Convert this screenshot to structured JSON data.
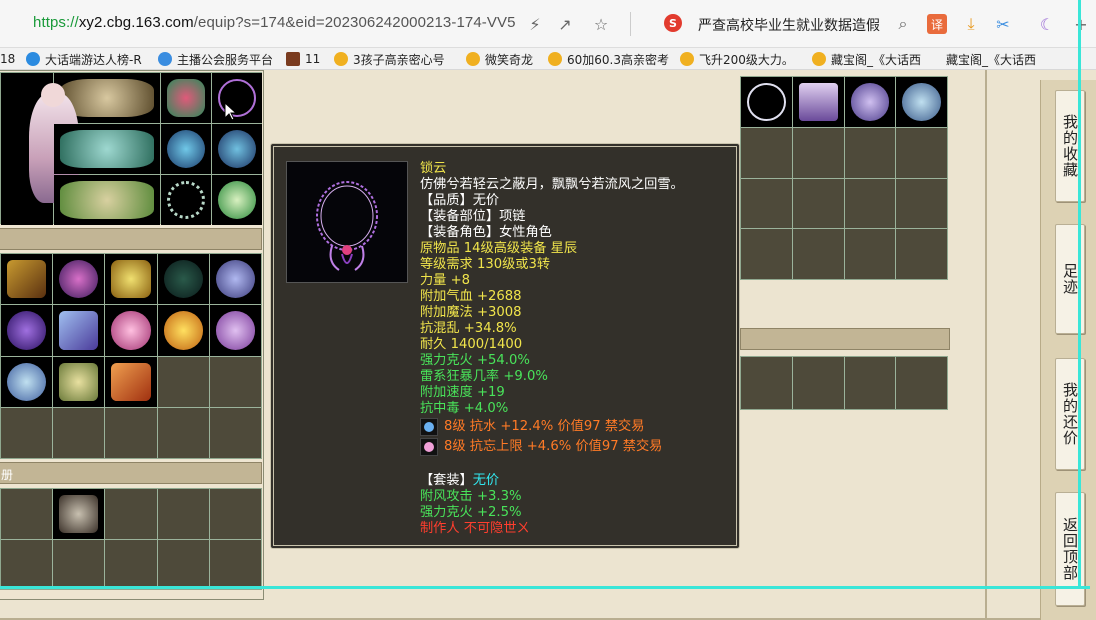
{
  "browser": {
    "url_proto": "https://",
    "url_host": "xy2.cbg.163.com",
    "url_path": "/equip?s=174&eid=202306242000213-174-VV5",
    "search_engine_letter": "S",
    "search_text": "严查高校毕业生就业数据造假",
    "translate_label": "译"
  },
  "bookmarks": [
    {
      "label": "18",
      "color": "#999999"
    },
    {
      "label": "大话端游达人榜-R",
      "color": "#2b8be0"
    },
    {
      "label": "主播公会服务平台",
      "color": "#3a8de0"
    },
    {
      "label": "11",
      "color": "#7a3b1f"
    },
    {
      "label": "3孩子高亲密心号",
      "color": "#f0b020"
    },
    {
      "label": "微笑奇龙",
      "color": "#f0b020"
    },
    {
      "label": "60加60.3高亲密考",
      "color": "#f0b020"
    },
    {
      "label": "飞升200级大力。",
      "color": "#f0b020"
    },
    {
      "label": "藏宝阁_《大话西",
      "color": "#f0b020"
    },
    {
      "label": "藏宝阁_《大话西",
      "color": "#f0b020"
    }
  ],
  "section_label_left": "册",
  "tooltip": {
    "name": "锁云",
    "desc": "仿佛兮若轻云之蔽月，飘飘兮若流风之回雪。",
    "quality": "【品质】无价",
    "slot": "【装备部位】项链",
    "role": "【装备角色】女性角色",
    "origin": "原物品 14级高级装备 星辰",
    "level_req": "等级需求 130级或3转",
    "strength": "力量 +8",
    "hp": "附加气血 +2688",
    "mp": "附加魔法 +3008",
    "anti_confuse": "抗混乱 +34.8%",
    "durability": "耐久 1400/1400",
    "fire_strong": "强力克火 +54.0%",
    "thunder_crit": "雷系狂暴几率 +9.0%",
    "speed": "附加速度 +19",
    "anti_poison": "抗中毒 +4.0%",
    "gem1": "8级 抗水 +12.4% 价值97 禁交易",
    "gem2": "8级 抗忘上限 +4.6% 价值97 禁交易",
    "set_prefix": "【套装】",
    "set_value": "无价",
    "set1": "附风攻击 +3.3%",
    "set2": "强力克火 +2.5%",
    "maker": "制作人 不可隐世ㄨ"
  },
  "sidebar": {
    "favorites": "我的收藏",
    "footprint": "足迹",
    "my_offer": "我的还价",
    "back_top": "返回顶部"
  }
}
